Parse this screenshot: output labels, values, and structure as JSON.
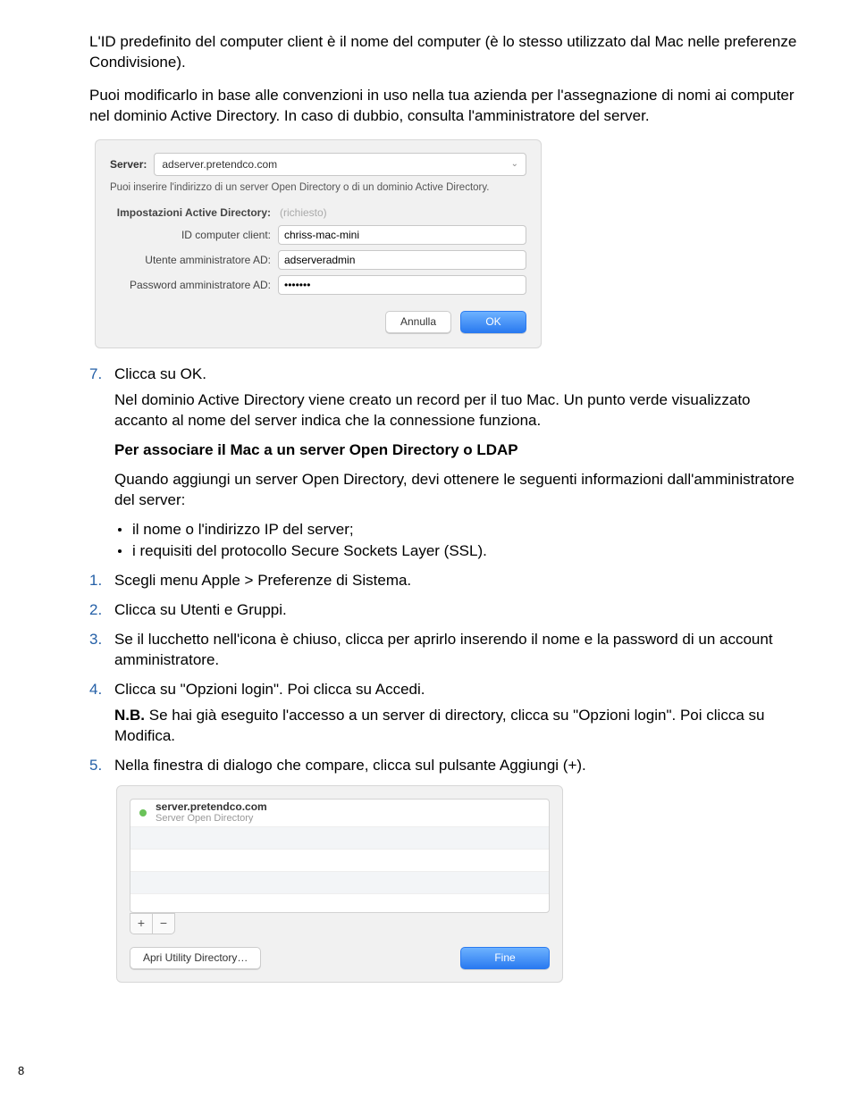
{
  "intro": {
    "p1": "L'ID predefinito del computer client è il nome del computer (è lo stesso utilizzato dal Mac nelle preferenze Condivisione).",
    "p2": "Puoi modificarlo in base alle convenzioni in uso nella tua azienda per l'assegnazione di nomi ai computer nel dominio Active Directory. In caso di dubbio, consulta l'amministratore del server."
  },
  "dialog1": {
    "server_label": "Server:",
    "server_value": "adserver.pretendco.com",
    "note": "Puoi inserire l'indirizzo di un server Open Directory o di un dominio Active Directory.",
    "ad_settings_label": "Impostazioni Active Directory:",
    "ad_settings_value": "(richiesto)",
    "client_id_label": "ID computer client:",
    "client_id_value": "chriss-mac-mini",
    "admin_user_label": "Utente amministratore AD:",
    "admin_user_value": "adserveradmin",
    "admin_pass_label": "Password amministratore AD:",
    "admin_pass_value": "•••••••",
    "cancel": "Annulla",
    "ok": "OK"
  },
  "step7": {
    "num": "7.",
    "text": "Clicca su OK.",
    "result": "Nel dominio Active Directory viene creato un record per il tuo Mac. Un punto verde visualizzato accanto al nome del server indica che la connessione funziona.",
    "subheading": "Per associare il Mac a un server Open Directory o LDAP",
    "subtext": "Quando aggiungi un server Open Directory, devi ottenere le seguenti informazioni dall'amministratore del server:",
    "bullets": [
      "il nome o l'indirizzo IP del server;",
      "i requisiti del protocollo Secure Sockets Layer (SSL)."
    ]
  },
  "steps": [
    {
      "num": "1.",
      "text": "Scegli menu Apple > Preferenze di Sistema."
    },
    {
      "num": "2.",
      "text": "Clicca su Utenti e Gruppi."
    },
    {
      "num": "3.",
      "text": "Se il lucchetto nell'icona è chiuso, clicca per aprirlo inserendo il nome e la password di un account amministratore."
    },
    {
      "num": "4.",
      "text": "Clicca su \"Opzioni login\". Poi clicca su Accedi.",
      "note_label": "N.B.",
      "note": "Se hai già eseguito l'accesso a un server di directory, clicca su \"Opzioni login\". Poi clicca su Modifica."
    },
    {
      "num": "5.",
      "text": "Nella finestra di dialogo che compare, clicca sul pulsante Aggiungi (+)."
    }
  ],
  "dialog2": {
    "server_name": "server.pretendco.com",
    "server_type": "Server Open Directory",
    "add": "+",
    "remove": "−",
    "open_util": "Apri Utility Directory…",
    "done": "Fine"
  },
  "page_number": "8"
}
